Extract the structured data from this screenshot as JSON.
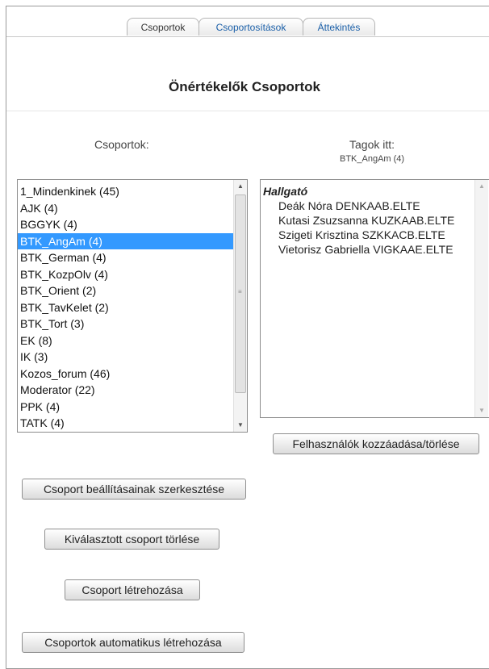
{
  "tabs": [
    {
      "label": "Csoportok",
      "active": true
    },
    {
      "label": "Csoportosítások",
      "active": false
    },
    {
      "label": "Áttekintés",
      "active": false
    }
  ],
  "page_title": "Önértékelők Csoportok",
  "groups_panel": {
    "label": "Csoportok:",
    "items": [
      "1_Mindenkinek (45)",
      "AJK (4)",
      "BGGYK (4)",
      "BTK_AngAm (4)",
      "BTK_German (4)",
      "BTK_KozpOlv (4)",
      "BTK_Orient (2)",
      "BTK_TavKelet (2)",
      "BTK_Tort (3)",
      "EK (8)",
      "IK (3)",
      "Kozos_forum (46)",
      "Moderator (22)",
      "PPK (4)",
      "TATK (4)"
    ],
    "selected": "BTK_AngAm (4)"
  },
  "members_panel": {
    "label": "Tagok itt:",
    "sublabel": "BTK_AngAm (4)",
    "role_heading": "Hallgató",
    "members": [
      "Deák Nóra DENKAAB.ELTE",
      "Kutasi Zsuzsanna KUZKAAB.ELTE",
      "Szigeti Krisztina SZKKACB.ELTE",
      "Vietorisz Gabriella VIGKAAE.ELTE"
    ]
  },
  "buttons": {
    "add_remove_users": "Felhasználók kozzáadása/törlése",
    "edit_group_settings": "Csoport beállításainak szerkesztése",
    "delete_selected_group": "Kiválasztott csoport törlése",
    "create_group": "Csoport létrehozása",
    "auto_create_groups": "Csoportok automatikus létrehozása"
  },
  "colors": {
    "selection": "#3399ff",
    "tab_link": "#1a5fa8"
  }
}
